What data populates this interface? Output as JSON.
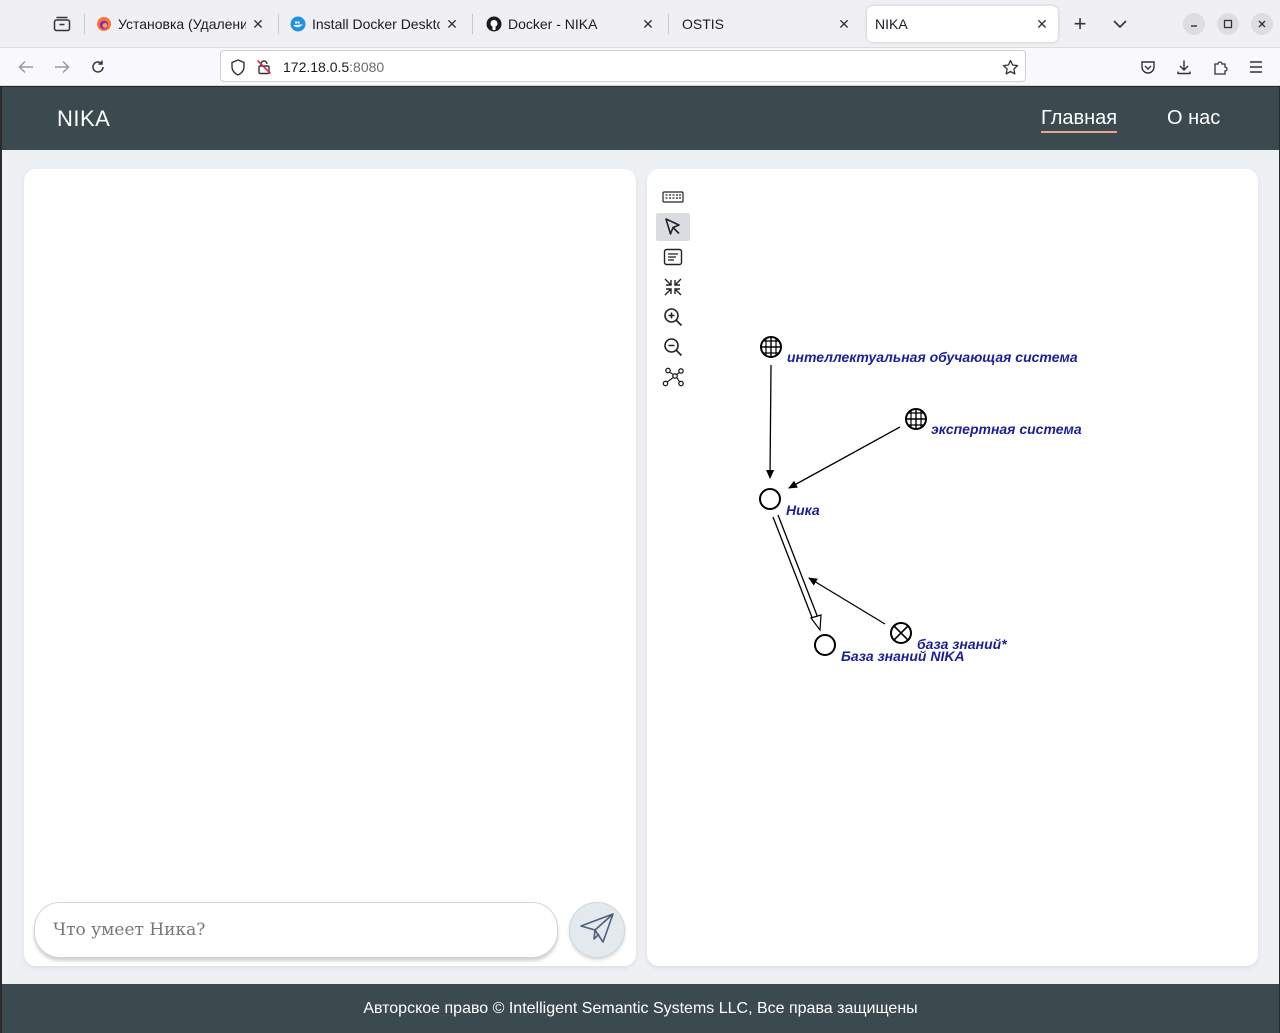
{
  "browser": {
    "tabs": [
      {
        "title": "Установка (Удаления",
        "favicon": "firefox-icon"
      },
      {
        "title": "Install Docker Deskto",
        "favicon": "docker-icon"
      },
      {
        "title": "Docker - NIKA",
        "favicon": "github-icon"
      },
      {
        "title": "OSTIS",
        "favicon": "none"
      },
      {
        "title": "NIKA",
        "favicon": "none",
        "active": true
      }
    ],
    "url": {
      "host": "172.18.0.5",
      "port": ":8080"
    },
    "accent_color": "#f0f0f4"
  },
  "site": {
    "brand": "NIKA",
    "nav": {
      "home": "Главная",
      "about": "О нас"
    },
    "header_color": "#3b4a4f"
  },
  "chat": {
    "input_placeholder": "Что умеет Ника?"
  },
  "graph": {
    "nodes": [
      {
        "id": "intelligent",
        "label": "интеллектуальная обучающая система",
        "kind": "class"
      },
      {
        "id": "expert",
        "label": "экспертная система",
        "kind": "class"
      },
      {
        "id": "nika",
        "label": "Ника",
        "kind": "node"
      },
      {
        "id": "kb_nika",
        "label": "База знаний NIKA",
        "kind": "node"
      },
      {
        "id": "kb",
        "label": "база знаний*",
        "kind": "relation"
      }
    ],
    "label_color": "#1b1f99"
  },
  "footer": {
    "text": "Авторское право © Intelligent Semantic Systems LLC, Все права защищены"
  }
}
